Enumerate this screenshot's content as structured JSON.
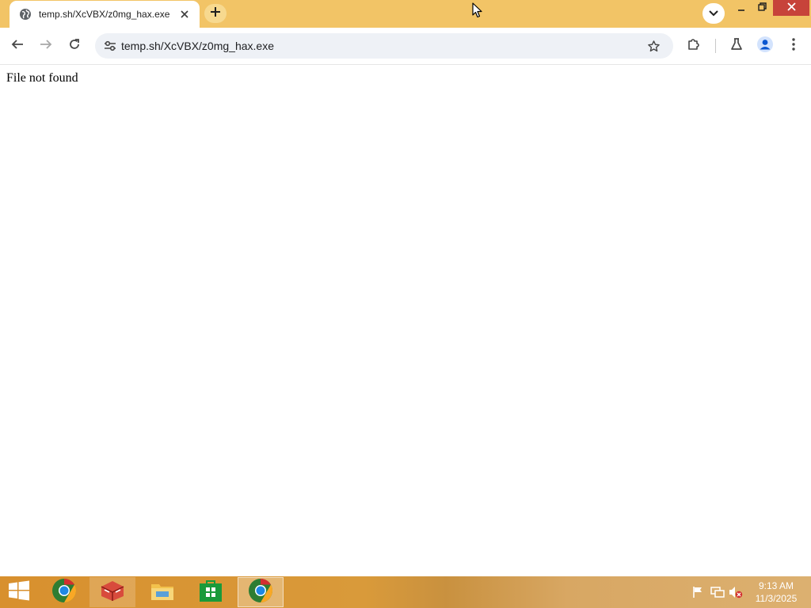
{
  "browser": {
    "tab": {
      "title": "temp.sh/XcVBX/z0mg_hax.exe",
      "favicon": "globe-icon",
      "close": "close-icon"
    },
    "new_tab": "plus-icon",
    "tab_search": "chevron-down-icon",
    "window_controls": [
      "minimize-icon",
      "restore-icon",
      "close-icon"
    ],
    "toolbar": {
      "back": "arrow-left-icon",
      "forward": "arrow-right-icon",
      "reload": "reload-icon",
      "address": "temp.sh/XcVBX/z0mg_hax.exe",
      "site_info": "tune-icon",
      "bookmark": "star-icon",
      "extensions": "puzzle-icon",
      "labs": "flask-icon",
      "profile": "person-icon",
      "menu": "kebab-menu-icon"
    },
    "colors": {
      "frame": "#f2c466",
      "omnibox": "#eef1f6",
      "close_hover": "#c7433a"
    }
  },
  "page": {
    "message": "File not found"
  },
  "taskbar": {
    "start": "windows-logo-icon",
    "apps": [
      "chrome-icon",
      "toolbox-icon",
      "file-explorer-icon",
      "store-icon",
      "chrome-icon"
    ],
    "tray": [
      "action-center-flag-icon",
      "network-icon",
      "volume-muted-icon"
    ],
    "clock": {
      "time": "9:13 AM",
      "date": "11/3/2025"
    }
  }
}
